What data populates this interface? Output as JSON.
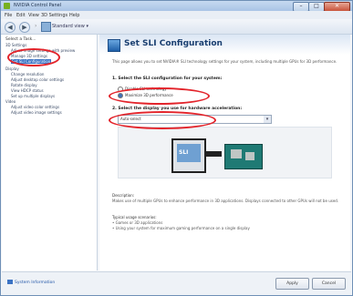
{
  "window": {
    "title": "NVIDIA Control Panel",
    "minimize": "–",
    "maximize": "□",
    "close": "✕"
  },
  "menu": {
    "file": "File",
    "edit": "Edit",
    "view": "View",
    "three_d": "3D Settings",
    "help": "Help"
  },
  "toolbar": {
    "back": "◀",
    "forward": "▶",
    "separator": "›",
    "home_label": "Standard view ▾"
  },
  "task_panel": {
    "header": "Select a Task...",
    "items": [
      "3D Settings",
      "Adjust image settings with preview",
      "Manage 3D settings",
      "Set SLI Configuration",
      "Display",
      "Change resolution",
      "Adjust desktop color settings",
      "Rotate display",
      "View HDCP status",
      "Set up multiple displays",
      "Video",
      "Adjust video color settings",
      "Adjust video image settings"
    ]
  },
  "page": {
    "title": "Set SLI Configuration",
    "description": "This page allows you to set NVIDIA® SLI technology settings for your system, including multiple GPUs for 3D performance.",
    "step1": "1. Select the SLI configuration for your system:",
    "radio_disable": "Disable SLI technology",
    "radio_maximize": "Maximize 3D performance",
    "step2": "2. Select the display you use for hardware acceleration:",
    "dropdown_value": "Auto-select",
    "dropdown_arrow": "▾",
    "sli_label": "SLI",
    "description_label": "Description:",
    "description_text": "Makes use of multiple GPUs to enhance performance in 3D applications. Displays connected to other GPUs will not be used.",
    "scenarios_label": "Typical usage scenarios:",
    "scenario1": "• Games or 3D applications",
    "scenario2": "• Using your system for maximum gaming performance on a single display"
  },
  "bottom": {
    "system_info": "System Information",
    "apply": "Apply",
    "cancel": "Cancel"
  },
  "colors": {
    "accent": "#3b73c4",
    "highlight_ring": "#e3242b",
    "brand": "#77b020"
  }
}
